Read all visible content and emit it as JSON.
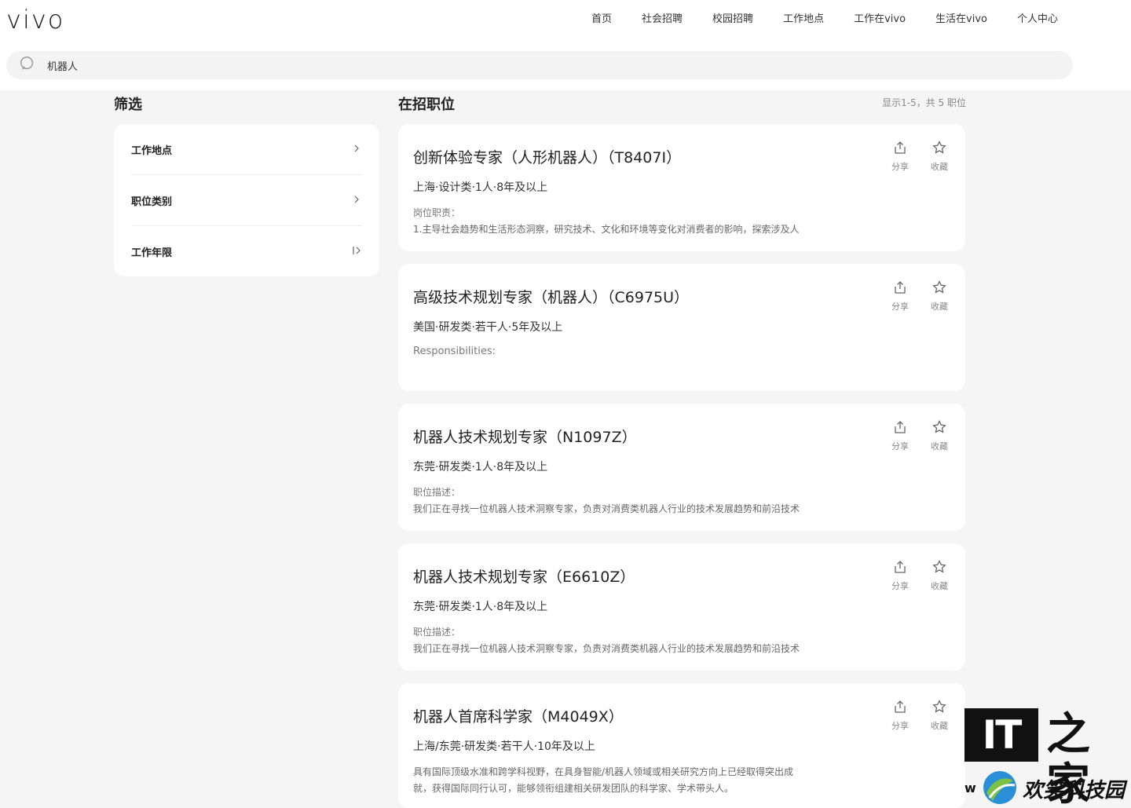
{
  "brand": {
    "logo_text": "vivo"
  },
  "nav": [
    "首页",
    "社会招聘",
    "校园招聘",
    "工作地点",
    "工作在vivo",
    "生活在vivo",
    "个人中心"
  ],
  "search": {
    "value": "机器人"
  },
  "filter": {
    "title": "筛选",
    "items": [
      {
        "label": "工作地点",
        "icon": "chevron-right-icon"
      },
      {
        "label": "职位类别",
        "icon": "chevron-right-icon"
      },
      {
        "label": "工作年限",
        "icon": "bar-chevron-right-icon"
      }
    ]
  },
  "jobs": {
    "title": "在招职位",
    "count_text": "显示1-5，共 5 职位",
    "share_label": "分享",
    "favorite_label": "收藏",
    "items": [
      {
        "title": "创新体验专家（人形机器人）（T8407I）",
        "meta": "上海·设计类·1人·8年及以上",
        "desc_label": "岗位职责：",
        "desc": "1.主导社会趋势和生活形态洞察，研究技术、文化和环境等变化对消费者的影响，探索涉及人"
      },
      {
        "title": "高级技术规划专家（机器人）（C6975U）",
        "meta": "美国·研发类·若干人·5年及以上",
        "desc_label": "Responsibilities:",
        "desc": ""
      },
      {
        "title": "机器人技术规划专家（N1097Z）",
        "meta": "东莞·研发类·1人·8年及以上",
        "desc_label": "职位描述：",
        "desc": "我们正在寻找一位机器人技术洞察专家，负责对消费类机器人行业的技术发展趋势和前沿技术"
      },
      {
        "title": "机器人技术规划专家（E6610Z）",
        "meta": "东莞·研发类·1人·8年及以上",
        "desc_label": "职位描述：",
        "desc": "我们正在寻找一位机器人技术洞察专家，负责对消费类机器人行业的技术发展趋势和前沿技术"
      },
      {
        "title": "机器人首席科学家（M4049X）",
        "meta": "上海/东莞·研发类·若干人·10年及以上",
        "desc_label": "具有国际顶级水准和跨学科视野，在具身智能/机器人领域或相关研究方向上已经取得突出成",
        "desc": "就，获得国际同行认可，能够领衔组建相关研发团队的科学家、学术带头人。"
      }
    ]
  },
  "watermark": {
    "top_left": "IT",
    "top_right": "之家",
    "initial": "w",
    "bottom": "欢笑科技园"
  }
}
